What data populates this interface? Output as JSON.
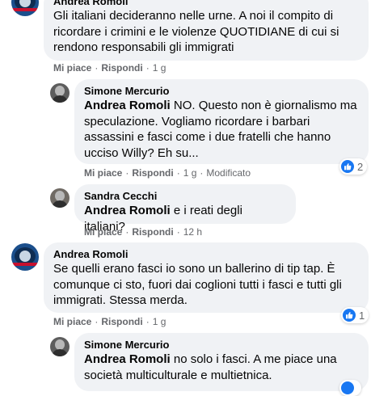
{
  "comments": [
    {
      "author": "Andrea Romoli",
      "text": "Gli italiani decideranno nelle urne. A noi il compito di ricordare i crimini e le violenze QUOTIDIANE di cui si rendono responsabili gli immigrati",
      "like_label": "Mi piace",
      "reply_label": "Rispondi",
      "time": "1 g"
    },
    {
      "author": "Simone Mercurio",
      "mention": "Andrea Romoli",
      "text": "NO. Questo non è giornalismo ma speculazione. Vogliamo ricordare i barbari assassini e fasci come i due fratelli che hanno ucciso Willy? Eh su...",
      "like_label": "Mi piace",
      "reply_label": "Rispondi",
      "time": "1 g",
      "edited": "Modificato",
      "reaction_count": "2"
    },
    {
      "author": "Sandra Cecchi",
      "mention": "Andrea Romoli",
      "text": "e i reati degli italiani?",
      "like_label": "Mi piace",
      "reply_label": "Rispondi",
      "time": "12 h"
    },
    {
      "author": "Andrea Romoli",
      "text": "Se quelli erano fasci io sono un ballerino di tip tap. È comunque ci sto, fuori dai coglioni tutti i fasci e tutti gli immigrati. Stessa merda.",
      "like_label": "Mi piace",
      "reply_label": "Rispondi",
      "time": "1 g",
      "reaction_count": "1"
    },
    {
      "author": "Simone Mercurio",
      "mention": "Andrea Romoli",
      "text": "no solo i fasci. A me piace una società multiculturale e multietnica."
    }
  ],
  "colors": {
    "bubble": "#f0f2f5",
    "secondary_text": "#65676b",
    "like_blue": "#1877f2"
  },
  "icons": {
    "like": "like-icon"
  }
}
